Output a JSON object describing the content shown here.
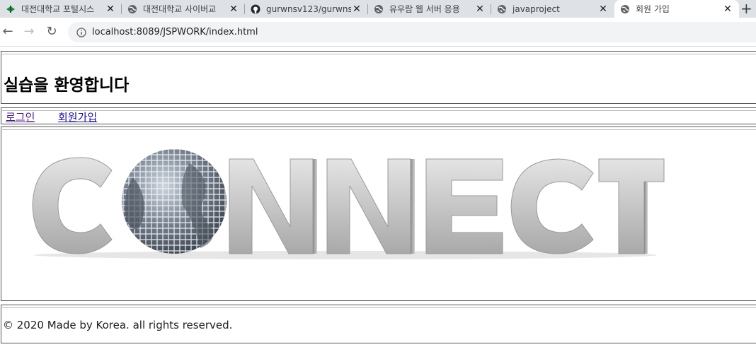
{
  "browser": {
    "tabs": [
      {
        "title": "대전대학교 포털시스",
        "icon": "leaf-favicon-icon",
        "active": false
      },
      {
        "title": "대전대학교 사이버교",
        "icon": "globe-icon",
        "active": false
      },
      {
        "title": "gurwnsv123/gurwns",
        "icon": "github-icon",
        "active": false
      },
      {
        "title": "유우람 웹 서버 응용",
        "icon": "globe-icon",
        "active": false
      },
      {
        "title": "javaproject",
        "icon": "globe-icon",
        "active": false
      },
      {
        "title": "회원 가입",
        "icon": "globe-icon",
        "active": true
      }
    ],
    "close_glyph": "✕",
    "new_tab_glyph": "+",
    "url": "localhost:8089/JSPWORK/index.html",
    "back_glyph": "←",
    "forward_glyph": "→",
    "reload_glyph": "↻"
  },
  "page": {
    "heading": "실습을 환영합니다",
    "nav": {
      "login": "로그인",
      "signup": "회원가입"
    },
    "logo_text": "CONNECT",
    "footer": "© 2020 Made by Korea. all rights reserved."
  },
  "colors": {
    "link_visited": "#4a1a8a",
    "link": "#1a0dab",
    "logo_metal": "#c9c9c9",
    "globe": "#5c6470"
  }
}
